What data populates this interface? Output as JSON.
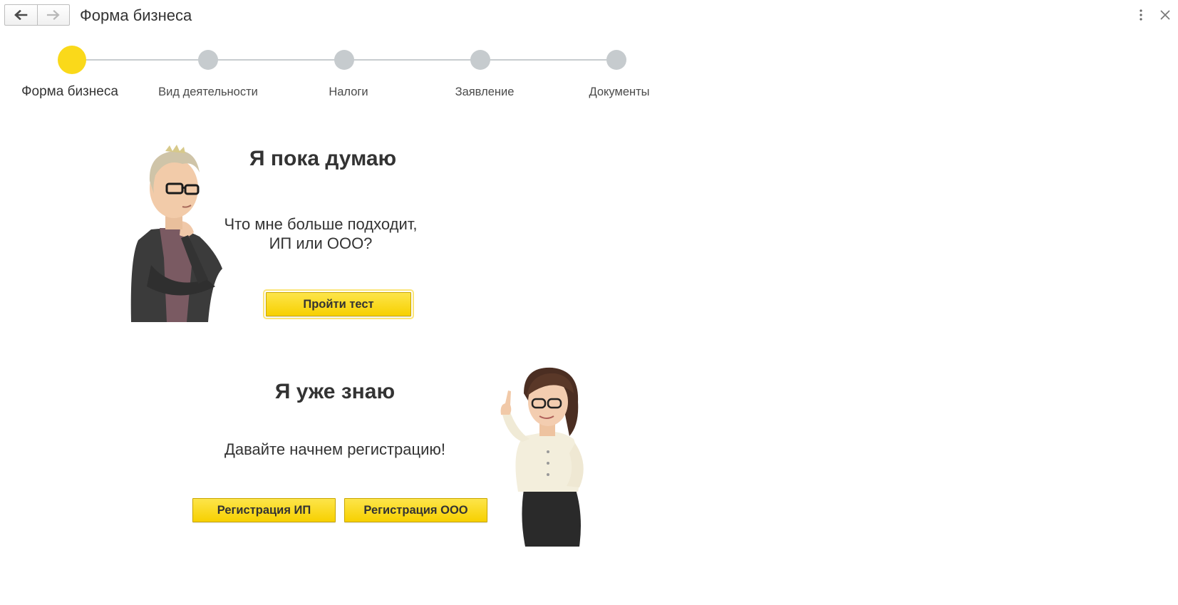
{
  "window": {
    "title": "Форма бизнеса"
  },
  "toolbar": {
    "back_icon": "arrow-left-icon",
    "forward_icon": "arrow-right-icon",
    "more_icon": "vertical-dots-icon",
    "close_icon": "close-icon"
  },
  "stepper": {
    "active_index": 0,
    "steps": [
      {
        "label": "Форма бизнеса"
      },
      {
        "label": "Вид деятельности"
      },
      {
        "label": "Налоги"
      },
      {
        "label": "Заявление"
      },
      {
        "label": "Документы"
      }
    ]
  },
  "thinking_block": {
    "title": "Я пока думаю",
    "text_line1": "Что мне больше подходит,",
    "text_line2": "ИП или ООО?",
    "button_label": "Пройти тест"
  },
  "knowing_block": {
    "title": "Я уже знаю",
    "text": "Давайте начнем регистрацию!",
    "button_ip_label": "Регистрация ИП",
    "button_ooo_label": "Регистрация ООО"
  },
  "colors": {
    "accent_yellow": "#fad91a",
    "step_inactive": "#c6cbce",
    "text": "#333333"
  }
}
